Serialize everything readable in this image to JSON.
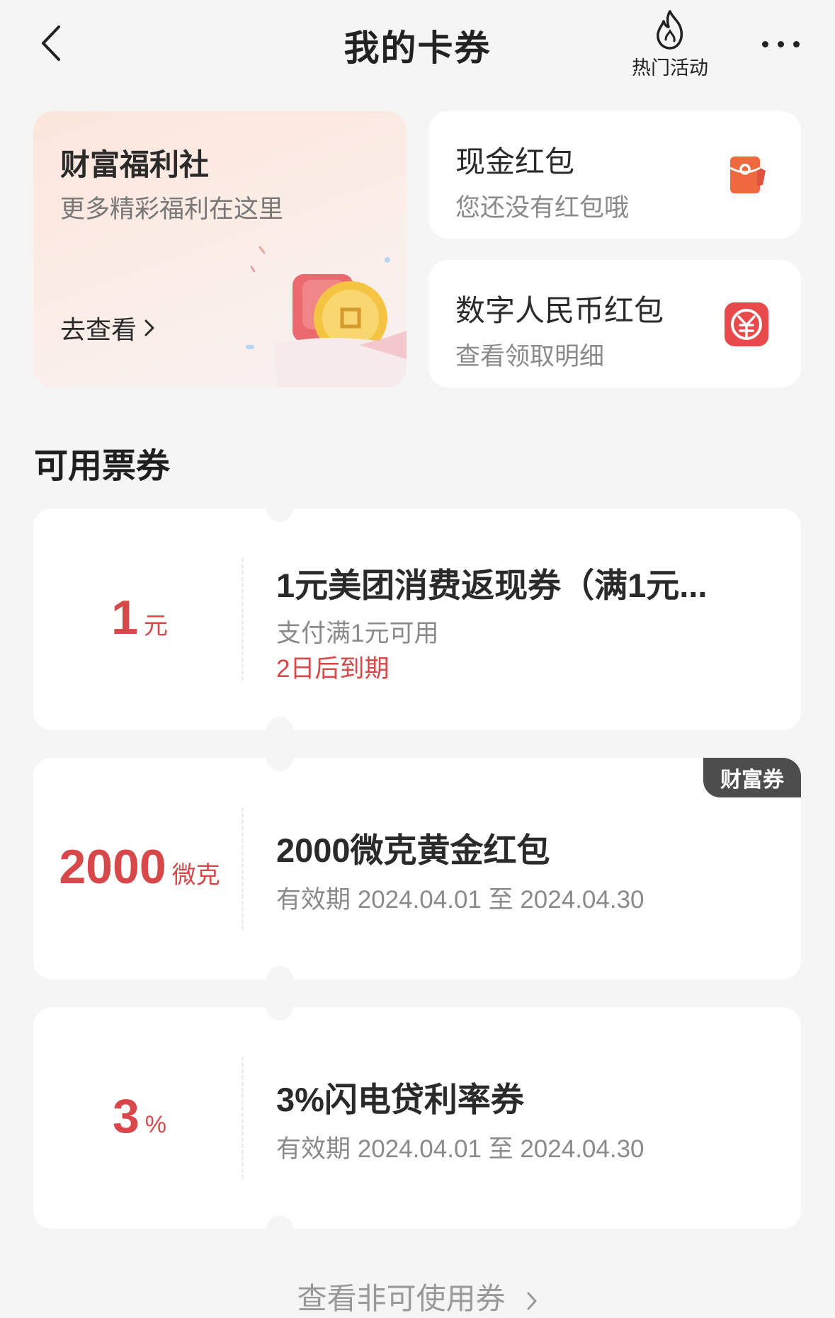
{
  "header": {
    "title": "我的卡券",
    "hot_label": "热门活动"
  },
  "promo": {
    "title": "财富福利社",
    "subtitle": "更多精彩福利在这里",
    "cta": "去查看"
  },
  "side_cards": [
    {
      "title": "现金红包",
      "subtitle": "您还没有红包哦",
      "icon": "red-envelope-icon"
    },
    {
      "title": "数字人民币红包",
      "subtitle": "查看领取明细",
      "icon": "digital-rmb-icon"
    }
  ],
  "section": {
    "title": "可用票券"
  },
  "coupons": [
    {
      "value": "1",
      "unit": "元",
      "title": "1元美团消费返现券（满1元...",
      "subtitle": "支付满1元可用",
      "expiry": "2日后到期",
      "tag": ""
    },
    {
      "value": "2000",
      "unit": "微克",
      "title": "2000微克黄金红包",
      "subtitle": "有效期 2024.04.01 至 2024.04.30",
      "expiry": "",
      "tag": "财富券"
    },
    {
      "value": "3",
      "unit": "%",
      "title": "3%闪电贷利率券",
      "subtitle": "有效期 2024.04.01 至 2024.04.30",
      "expiry": "",
      "tag": ""
    }
  ],
  "footer": {
    "link": "查看非可使用券"
  },
  "colors": {
    "accent": "#d8474a",
    "background": "#f5f5f5",
    "tag_bg": "#4d4d4d"
  }
}
